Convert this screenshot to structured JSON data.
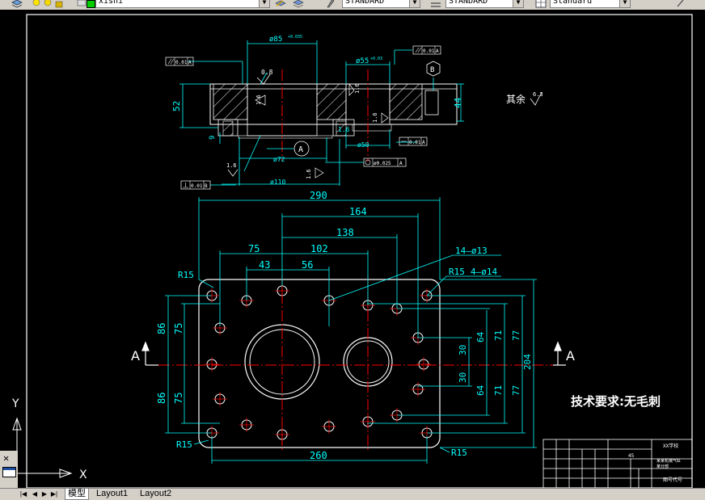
{
  "toolbar": {
    "layer_value": "xishi",
    "text_style": "STANDARD",
    "dim_style": "STANDARD",
    "table_style": "Standard"
  },
  "tabs": {
    "model": "模型",
    "layout1": "Layout1",
    "layout2": "Layout2"
  },
  "ucs": {
    "x_label": "X",
    "y_label": "Y"
  },
  "drawing": {
    "top_view": {
      "dim_bore_top": "ø85",
      "bore_top_tol": "+0.035",
      "dim_bore_right": "ø55",
      "bore_right_tol": "+0.03",
      "dim_height_left": "52",
      "dim_height_right": "44",
      "dim_9": "9",
      "dim_72": "ø72",
      "dim_110": "ø110",
      "dim_50": "ø50",
      "roughness_08": "0.8",
      "roughness_16a": "1.6",
      "roughness_16b": "1.6",
      "roughness_16c": "1.6",
      "roughness_16d": "1.6",
      "roughness_16e": "1.6",
      "datum_a": "A",
      "datum_b": "B",
      "tol_parallel_a": "0.01",
      "tol_parallel_a_ref": "A",
      "tol_parallel_b": "0.01",
      "tol_parallel_b_ref": "A",
      "tol_flat": "0.01",
      "tol_flat_ref": "A",
      "tol_perp": "0.01",
      "tol_perp_ref": "B",
      "tol_pos": "ø0.025",
      "tol_pos_ref": "A",
      "rest_label": "其余",
      "rest_value": "6.3"
    },
    "plan_view": {
      "dim_290": "290",
      "dim_164": "164",
      "dim_138": "138",
      "dim_102": "102",
      "dim_75": "75",
      "dim_43": "43",
      "dim_56": "56",
      "note_holes_13": "14—ø13",
      "note_r15_top": "R15",
      "note_r15_tr": "R15",
      "note_holes_14": "4—ø14",
      "note_r15_bl": "R15",
      "note_r15_br": "R15",
      "dim_86_top": "86",
      "dim_75_top": "75",
      "dim_86_bot": "86",
      "dim_75_bot": "75",
      "dim_30_top": "30",
      "dim_30_bot": "30",
      "dim_64_top": "64",
      "dim_64_bot": "64",
      "dim_71_top": "71",
      "dim_71_bot": "71",
      "dim_77_top": "77",
      "dim_77_bot": "77",
      "dim_204": "204",
      "dim_260": "260",
      "section_left": "A",
      "section_right": "A"
    },
    "tech_req": "技术要求:无毛刺",
    "title_block": {
      "school": "XX学校",
      "part_name_1": "某某机械气缸",
      "part_name_2": "某分部",
      "material": "45",
      "drawing_no": "图号代号"
    }
  },
  "colors": {
    "background": "#000000",
    "outline": "#ffffff",
    "dimension": "#00ffff",
    "center_line": "#ff0000",
    "hatch": "#ffffff",
    "text": "#ffffff",
    "ui_gray": "#d4d0c8"
  }
}
